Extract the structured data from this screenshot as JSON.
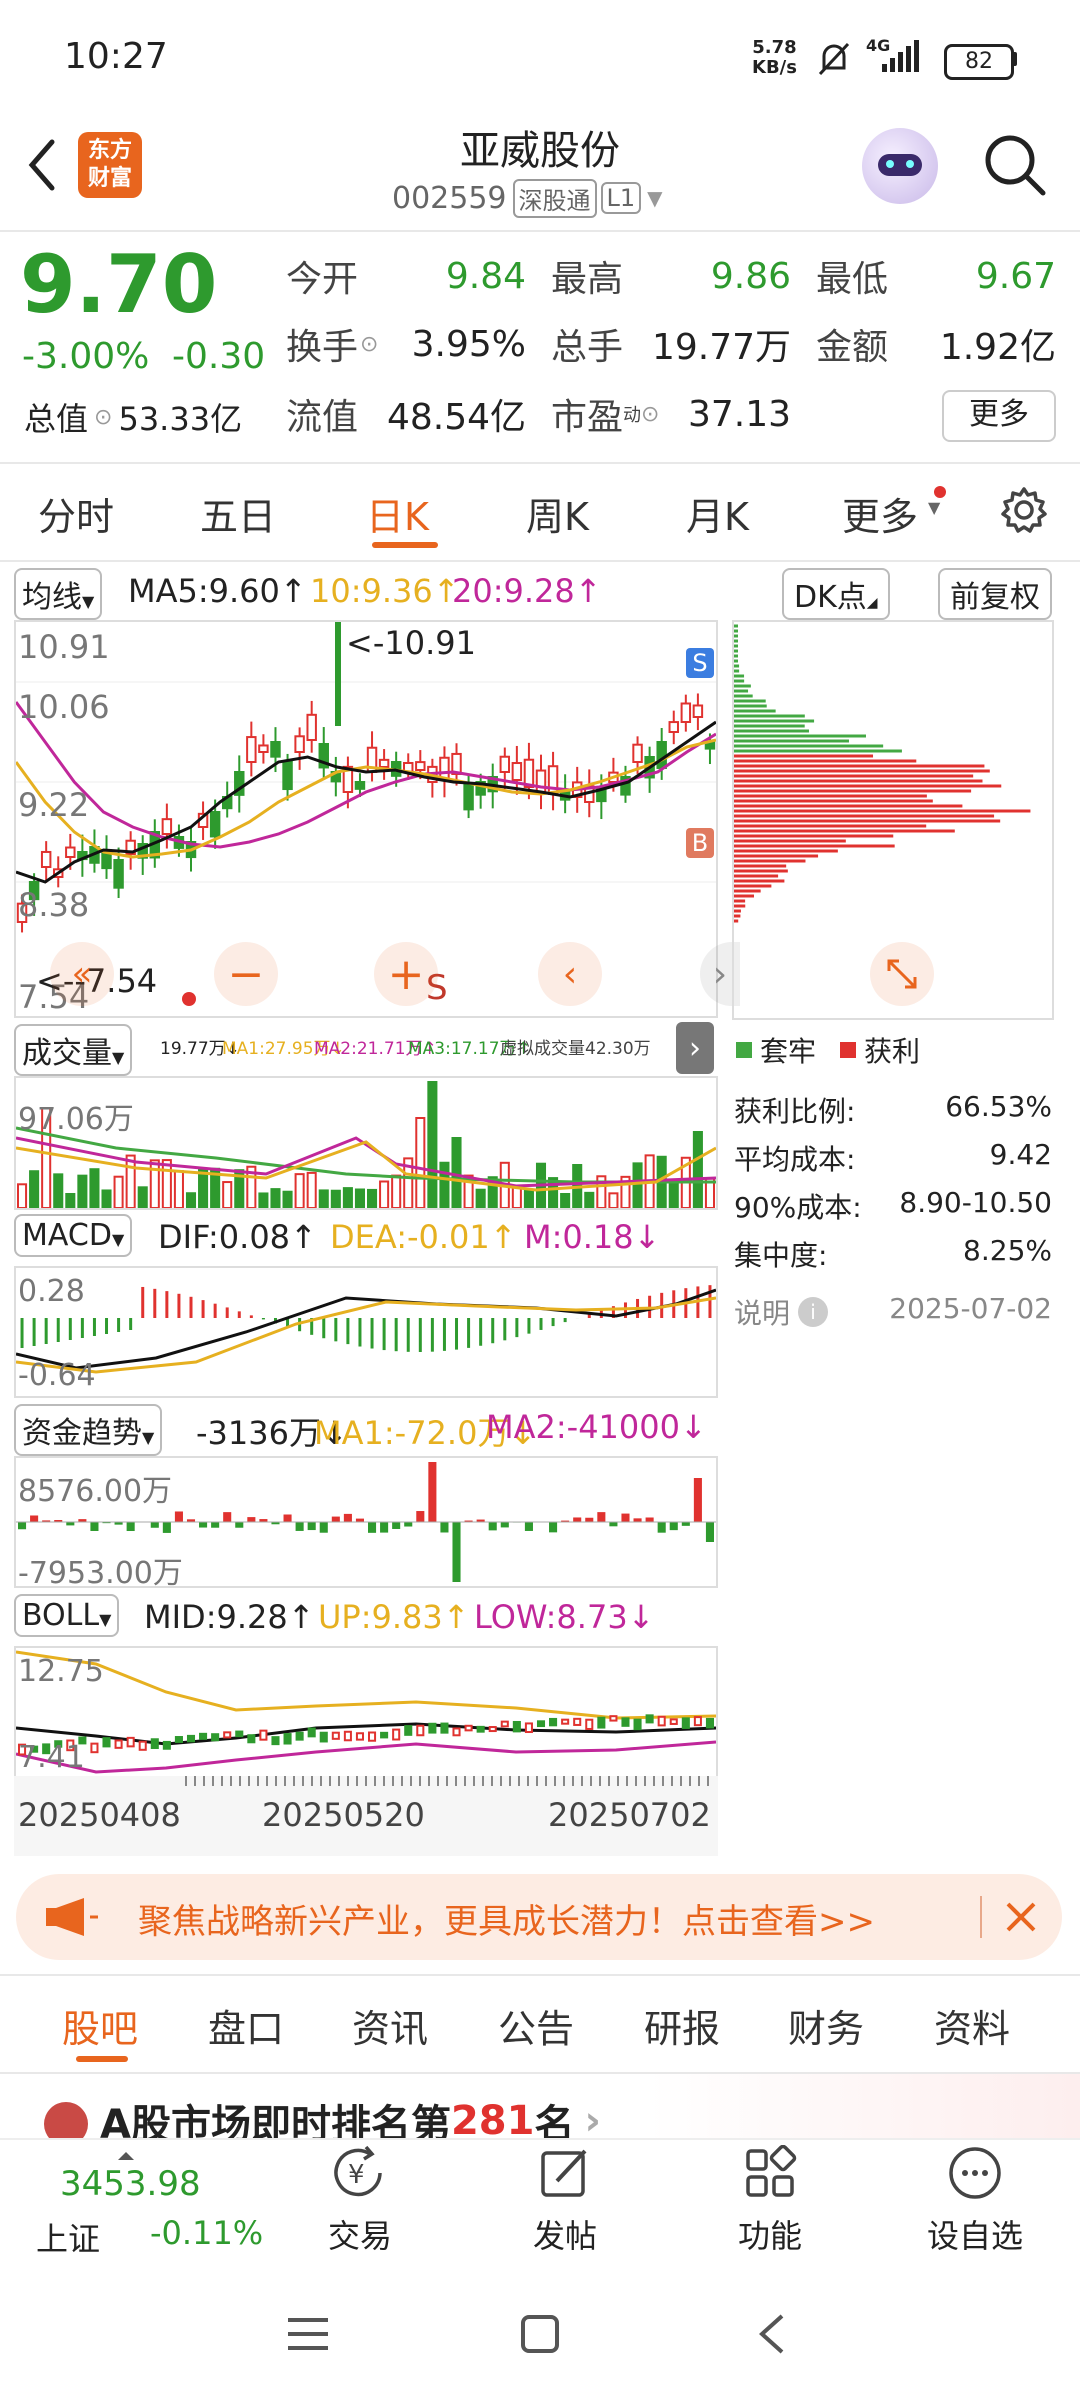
{
  "status": {
    "time": "10:27",
    "net_speed_top": "5.78",
    "net_speed_bottom": "KB/s",
    "network": "4G",
    "battery": "82"
  },
  "header": {
    "logo_text_top": "东方",
    "logo_text_bottom": "财富",
    "title": "亚威股份",
    "code": "002559",
    "tag1": "深股通",
    "tag2": "L1"
  },
  "quote": {
    "price": "9.70",
    "change_pct": "-3.00%",
    "change": "-0.30",
    "open_label": "今开",
    "open": "9.84",
    "high_label": "最高",
    "high": "9.86",
    "low_label": "最低",
    "low": "9.67",
    "turnover_label": "换手",
    "turnover": "3.95%",
    "volume_label": "总手",
    "volume": "19.77万",
    "amount_label": "金额",
    "amount": "1.92亿",
    "mktcap_label": "总值",
    "mktcap": "53.33亿",
    "float_label": "流值",
    "float": "48.54亿",
    "pe_label": "市盈",
    "pe_sup": "动",
    "pe": "37.13",
    "more_button": "更多"
  },
  "tabs": [
    "分时",
    "五日",
    "日K",
    "周K",
    "月K",
    "更多"
  ],
  "active_tab": 2,
  "kline_legend": {
    "ma_select": "均线",
    "ma5": "MA5:9.60↑",
    "ma10": "10:9.36↑",
    "ma20": "20:9.28↑",
    "dk_button": "DK点",
    "adjust_button": "前复权",
    "y_labels": [
      "10.91",
      "10.06",
      "9.22",
      "8.38",
      "7.54"
    ],
    "max_note": "<-10.91",
    "min_note": "<--7.54",
    "badge_s": "S",
    "badge_b": "B",
    "marker_s": "S"
  },
  "volume_panel": {
    "select": "成交量",
    "text": "19.77万↓",
    "ma1": "MA1:27.95万↓",
    "ma2": "MA2:21.71万↑",
    "ma3": "MA3:17.17万↑",
    "virtual": "虚拟成交量42.30万",
    "y_label": "97.06万"
  },
  "macd_panel": {
    "select": "MACD",
    "dif": "DIF:0.08↑",
    "dea": "DEA:-0.01↑",
    "m": "M:0.18↓",
    "y_top": "0.28",
    "y_bottom": "-0.64"
  },
  "fund_panel": {
    "select": "资金趋势",
    "value": "-3136万↓",
    "ma1": "MA1:-72.0万↓",
    "ma2": "MA2:-41000↓",
    "y_top": "8576.00万",
    "y_bottom": "-7953.00万"
  },
  "boll_panel": {
    "select": "BOLL",
    "mid": "MID:9.28↑",
    "up": "UP:9.83↑",
    "low": "LOW:8.73↓",
    "y_top": "12.75",
    "y_bottom": "7.41"
  },
  "dates": [
    "20250408",
    "20250520",
    "20250702"
  ],
  "chip": {
    "legend_trapped": "套牢",
    "legend_profit": "获利",
    "rows": [
      {
        "label": "获利比例:",
        "value": "66.53%"
      },
      {
        "label": "平均成本:",
        "value": "9.42"
      },
      {
        "label": "90%成本:",
        "value": "8.90-10.50"
      },
      {
        "label": "集中度:",
        "value": "8.25%"
      }
    ],
    "note_label": "说明",
    "note_date": "2025-07-02"
  },
  "banner": {
    "text": "聚焦战略新兴产业，更具成长潜力！点击查看>>"
  },
  "bottom_tabs": [
    "股吧",
    "盘口",
    "资讯",
    "公告",
    "研报",
    "财务",
    "资料"
  ],
  "active_bottom_tab": 0,
  "peek": {
    "text_prefix": "A股市场即时排名第",
    "rank": "281",
    "text_suffix": "名"
  },
  "index": {
    "value": "3453.98",
    "name": "上证",
    "change": "-0.11%"
  },
  "bottom_nav": [
    "交易",
    "发帖",
    "功能",
    "设自选"
  ],
  "colors": {
    "up": "#e0322f",
    "down": "#2e9a2e",
    "accent": "#e8651e",
    "ma10": "#e6b020",
    "ma20": "#c0279a"
  }
}
